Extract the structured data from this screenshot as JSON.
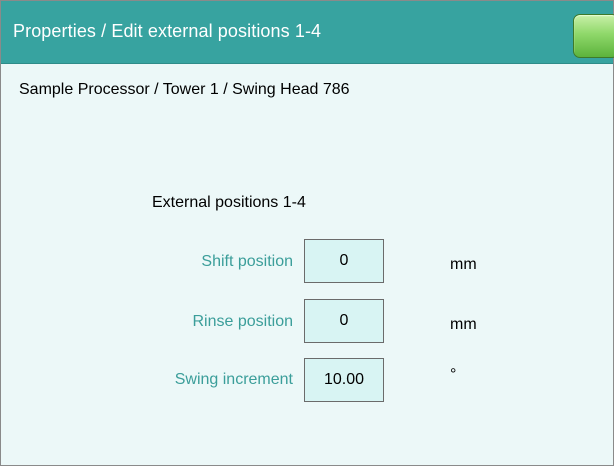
{
  "window": {
    "title": "Properties / Edit external positions 1-4",
    "ok_button_icon": "ok-icon",
    "accent_color": "#37a3a0"
  },
  "breadcrumb": "Sample Processor / Tower 1 / Swing Head 786",
  "section": {
    "heading": "External positions 1-4"
  },
  "fields": [
    {
      "label": "Shift position",
      "value": "0",
      "unit": "mm"
    },
    {
      "label": "Rinse position",
      "value": "0",
      "unit": "mm"
    },
    {
      "label": "Swing increment",
      "value": "10.00",
      "unit": "°"
    }
  ]
}
